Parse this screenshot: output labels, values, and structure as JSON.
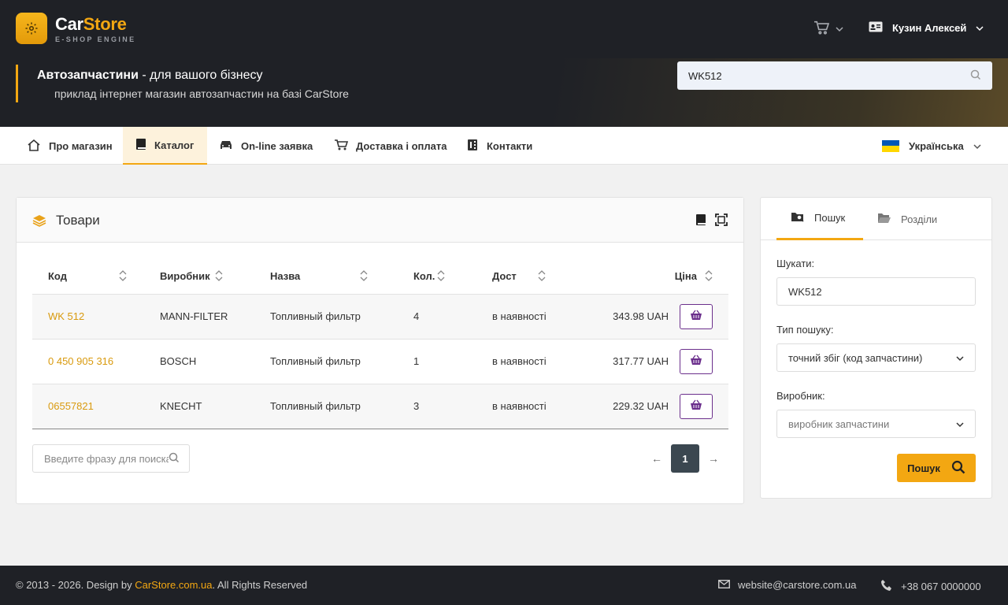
{
  "brand": {
    "name_part1": "Car",
    "name_part2": "Store",
    "tagline": "E-SHOP ENGINE",
    "accent_color": "#f3a712",
    "logo_icon": "gear-icon"
  },
  "header": {
    "cart_icon": "cart-icon",
    "user_name": "Кузин Алексей",
    "user_icon": "id-card-icon"
  },
  "hero": {
    "title_bold": "Автозапчастини",
    "title_rest": " - для вашого бізнесу",
    "subtitle": "приклад інтернет магазин автозапчастин на базі CarStore",
    "search_value": "WK512"
  },
  "nav": {
    "items": [
      {
        "label": "Про магазин",
        "icon": "home-icon"
      },
      {
        "label": "Каталог",
        "icon": "book-icon"
      },
      {
        "label": "On-line заявка",
        "icon": "car-icon"
      },
      {
        "label": "Доставка і оплата",
        "icon": "cart-icon"
      },
      {
        "label": "Контакти",
        "icon": "phone-book-icon"
      }
    ],
    "language": "Українська",
    "flag_colors": [
      "#0057b7",
      "#ffd700"
    ]
  },
  "products": {
    "title": "Товари",
    "columns": [
      "Код",
      "Виробник",
      "Назва",
      "Кол.",
      "Дост",
      "Ціна"
    ],
    "rows": [
      {
        "code": "WK 512",
        "maker": "MANN-FILTER",
        "name": "Топливный фильтр",
        "qty": "4",
        "avail": "в наявності",
        "price": "343.98 UAH"
      },
      {
        "code": "0 450 905 316",
        "maker": "BOSCH",
        "name": "Топливный фильтр",
        "qty": "1",
        "avail": "в наявності",
        "price": "317.77 UAH"
      },
      {
        "code": "06557821",
        "maker": "KNECHT",
        "name": "Топливный фильтр",
        "qty": "3",
        "avail": "в наявності",
        "price": "229.32 UAH"
      }
    ],
    "filter_placeholder": "Введите фразу для поиска",
    "pager": {
      "prev": "←",
      "current": "1",
      "next": "→"
    }
  },
  "side": {
    "tab_search": "Пошук",
    "tab_sections": "Розділи",
    "search_label": "Шукати:",
    "search_value": "WK512",
    "type_label": "Тип пошуку:",
    "type_value": "точний збіг (код запчастини)",
    "maker_label": "Виробник:",
    "maker_placeholder": "виробник запчастини",
    "button": "Пошук"
  },
  "footer": {
    "copy_prefix": "© 2013 - 2026. Design by ",
    "copy_link": "CarStore.com.ua",
    "copy_suffix": ". All Rights Reserved",
    "email": "website@carstore.com.ua",
    "phone": "+38 067 0000000"
  }
}
